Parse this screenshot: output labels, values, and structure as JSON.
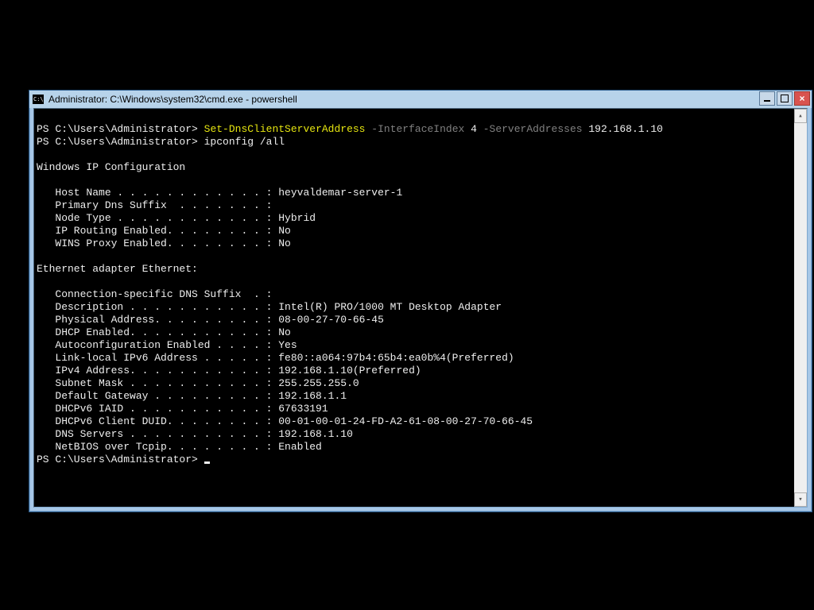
{
  "window": {
    "title": "Administrator: C:\\Windows\\system32\\cmd.exe - powershell"
  },
  "terminal": {
    "prompt": "PS C:\\Users\\Administrator> ",
    "cmd1": {
      "name": "Set-DnsClientServerAddress",
      "param1": " -InterfaceIndex",
      "val1": " 4",
      "param2": " -ServerAddresses",
      "val2": " 192.168.1.10"
    },
    "cmd2": "ipconfig /all",
    "sectionA": "Windows IP Configuration",
    "linesA": [
      "   Host Name . . . . . . . . . . . . : heyvaldemar-server-1",
      "   Primary Dns Suffix  . . . . . . . :",
      "   Node Type . . . . . . . . . . . . : Hybrid",
      "   IP Routing Enabled. . . . . . . . : No",
      "   WINS Proxy Enabled. . . . . . . . : No"
    ],
    "sectionB": "Ethernet adapter Ethernet:",
    "linesB": [
      "   Connection-specific DNS Suffix  . :",
      "   Description . . . . . . . . . . . : Intel(R) PRO/1000 MT Desktop Adapter",
      "   Physical Address. . . . . . . . . : 08-00-27-70-66-45",
      "   DHCP Enabled. . . . . . . . . . . : No",
      "   Autoconfiguration Enabled . . . . : Yes",
      "   Link-local IPv6 Address . . . . . : fe80::a064:97b4:65b4:ea0b%4(Preferred)",
      "   IPv4 Address. . . . . . . . . . . : 192.168.1.10(Preferred)",
      "   Subnet Mask . . . . . . . . . . . : 255.255.255.0",
      "   Default Gateway . . . . . . . . . : 192.168.1.1",
      "   DHCPv6 IAID . . . . . . . . . . . : 67633191",
      "   DHCPv6 Client DUID. . . . . . . . : 00-01-00-01-24-FD-A2-61-08-00-27-70-66-45",
      "   DNS Servers . . . . . . . . . . . : 192.168.1.10",
      "   NetBIOS over Tcpip. . . . . . . . : Enabled"
    ]
  }
}
